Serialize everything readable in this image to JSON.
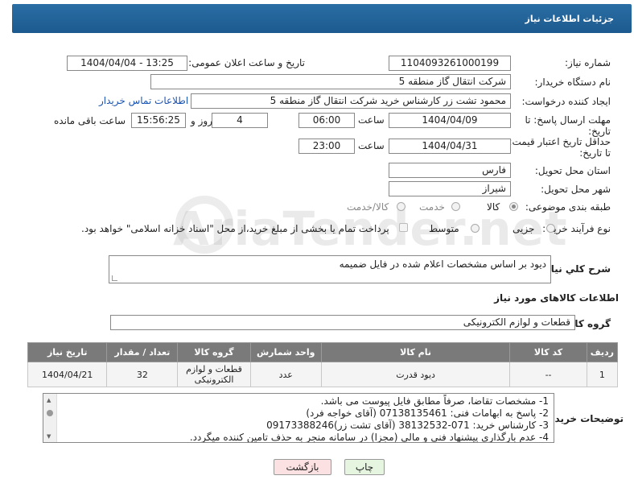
{
  "header": {
    "title": "جزئیات اطلاعات نیاز"
  },
  "labels": {
    "need_number": "شماره نیاز:",
    "announce_datetime": "تاریخ و ساعت اعلان عمومی:",
    "buyer_org": "نام دستگاه خریدار:",
    "request_creator": "ایجاد کننده درخواست:",
    "reply_deadline": "مهلت ارسال پاسخ: تا تاریخ:",
    "hour": "ساعت",
    "day_and": "روز و",
    "remaining": "ساعت باقی مانده",
    "price_validity": "حداقل تاریخ اعتبار قیمت: تا تاریخ:",
    "delivery_province": "استان محل تحویل:",
    "delivery_city": "شهر محل تحویل:",
    "category": "طبقه بندی موضوعی:",
    "purchase_type": "نوع فرآیند خرید :",
    "general_desc": "شرح كلي نياز:",
    "goods_info": "اطلاعات کالاهای مورد نیاز",
    "goods_group": "گروه کالا:",
    "buyer_notes": "توضیحات خریدار:"
  },
  "fields": {
    "need_number": "1104093261000199",
    "announce_datetime": "1404/04/04 - 13:25",
    "buyer_org": "شرکت انتقال گاز منطقه 5",
    "request_creator": "محمود تشت زر کارشناس خرید شرکت انتقال گاز منطقه 5",
    "contact_link": "اطلاعات تماس خریدار",
    "reply_date": "1404/04/09",
    "reply_time": "06:00",
    "reply_days": "4",
    "remaining_time": "15:56:25",
    "validity_date": "1404/04/31",
    "validity_time": "23:00",
    "province": "فارس",
    "city": "شیراز",
    "general_desc": "دیود بر اساس مشخصات اعلام شده در فایل ضمیمه",
    "goods_group": "قطعات و لوازم الکترونیکی"
  },
  "category_options": [
    {
      "label": "کالا",
      "selected": true
    },
    {
      "label": "خدمت",
      "selected": false
    },
    {
      "label": "کالا/خدمت",
      "selected": false
    }
  ],
  "purchase_options": [
    {
      "label": "جزیی",
      "selected": false
    },
    {
      "label": "متوسط",
      "selected": false
    }
  ],
  "payment_note": "پرداخت تمام یا بخشی از مبلغ خرید،از محل \"اسناد خزانه اسلامی\" خواهد بود.",
  "table": {
    "headers": [
      "ردیف",
      "کد کالا",
      "نام کالا",
      "واحد شمارش",
      "گروه کالا",
      "تعداد / مقدار",
      "تاریخ نیاز"
    ],
    "rows": [
      [
        "1",
        "--",
        "دیود قدرت",
        "عدد",
        "قطعات و لوازم الکترونیکی",
        "32",
        "1404/04/21"
      ]
    ]
  },
  "notes": [
    "1-  مشخصات تقاضا، صرفاً مطابق فایل پیوست می باشد.",
    "2- پاسخ به ابهامات فنی: 07138135461 (آقای خواجه فرد)",
    "3- کارشناس خرید: 071-38132532 (آقای تشت زر)09173388246",
    "4- عدم بارگذاری پیشنهاد فنی و مالی (مجزا) در سامانه منجر به حذف تامین کننده میگردد."
  ],
  "buttons": {
    "print": "چاپ",
    "back": "بازگشت"
  },
  "watermark": "AriaTender.net",
  "colors": {
    "header": "#1f5f94",
    "link": "#1a54b4",
    "print_bg": "#e6f5e0",
    "back_bg": "#fbe1e1"
  }
}
